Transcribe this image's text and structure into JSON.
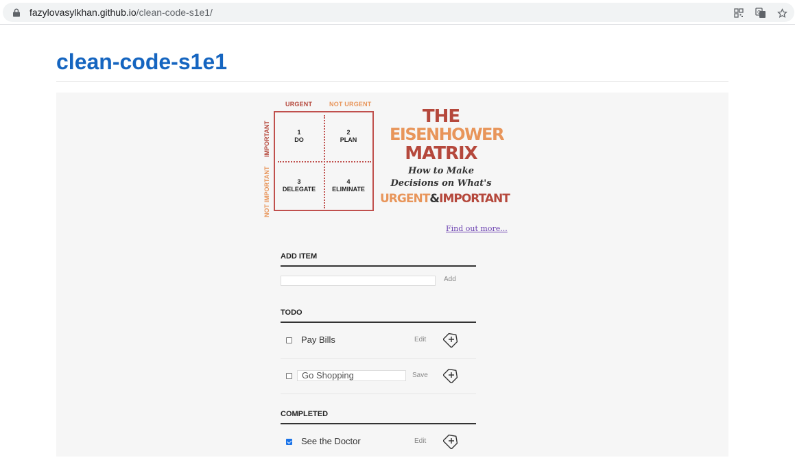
{
  "browser": {
    "url_host": "fazylovasylkhan.github.io",
    "url_path": "/clean-code-s1e1/",
    "icons": [
      "lock-icon",
      "qr-code-icon",
      "translate-icon",
      "bookmark-star-icon"
    ]
  },
  "page": {
    "title": "clean-code-s1e1"
  },
  "matrix": {
    "col_urgent": "URGENT",
    "col_not_urgent": "NOT URGENT",
    "row_important": "IMPORTANT",
    "row_not_important": "NOT IMPORTANT",
    "cells": [
      {
        "num": "1",
        "label": "DO"
      },
      {
        "num": "2",
        "label": "PLAN"
      },
      {
        "num": "3",
        "label": "DELEGATE"
      },
      {
        "num": "4",
        "label": "ELIMINATE"
      }
    ],
    "title_line1": "THE",
    "title_line2": "EISENHOWER",
    "title_line3": "MATRIX",
    "subtitle_line1": "How to Make",
    "subtitle_line2": "Decisions on What's",
    "subtitle_urgent": "URGENT",
    "subtitle_amp": "&",
    "subtitle_important": "IMPORTANT",
    "find_more": "Find out more...",
    "colors": {
      "red": "#b5483c",
      "orange": "#e8955a"
    }
  },
  "add_item": {
    "heading": "ADD ITEM",
    "button": "Add",
    "value": ""
  },
  "todo": {
    "heading": "TODO",
    "items": [
      {
        "label": "Pay Bills",
        "action": "Edit",
        "checked": false
      },
      {
        "label": "Go Shopping",
        "action": "Save",
        "checked": false,
        "editing": true
      }
    ]
  },
  "completed": {
    "heading": "COMPLETED",
    "items": [
      {
        "label": "See the Doctor",
        "action": "Edit",
        "checked": true
      }
    ]
  }
}
